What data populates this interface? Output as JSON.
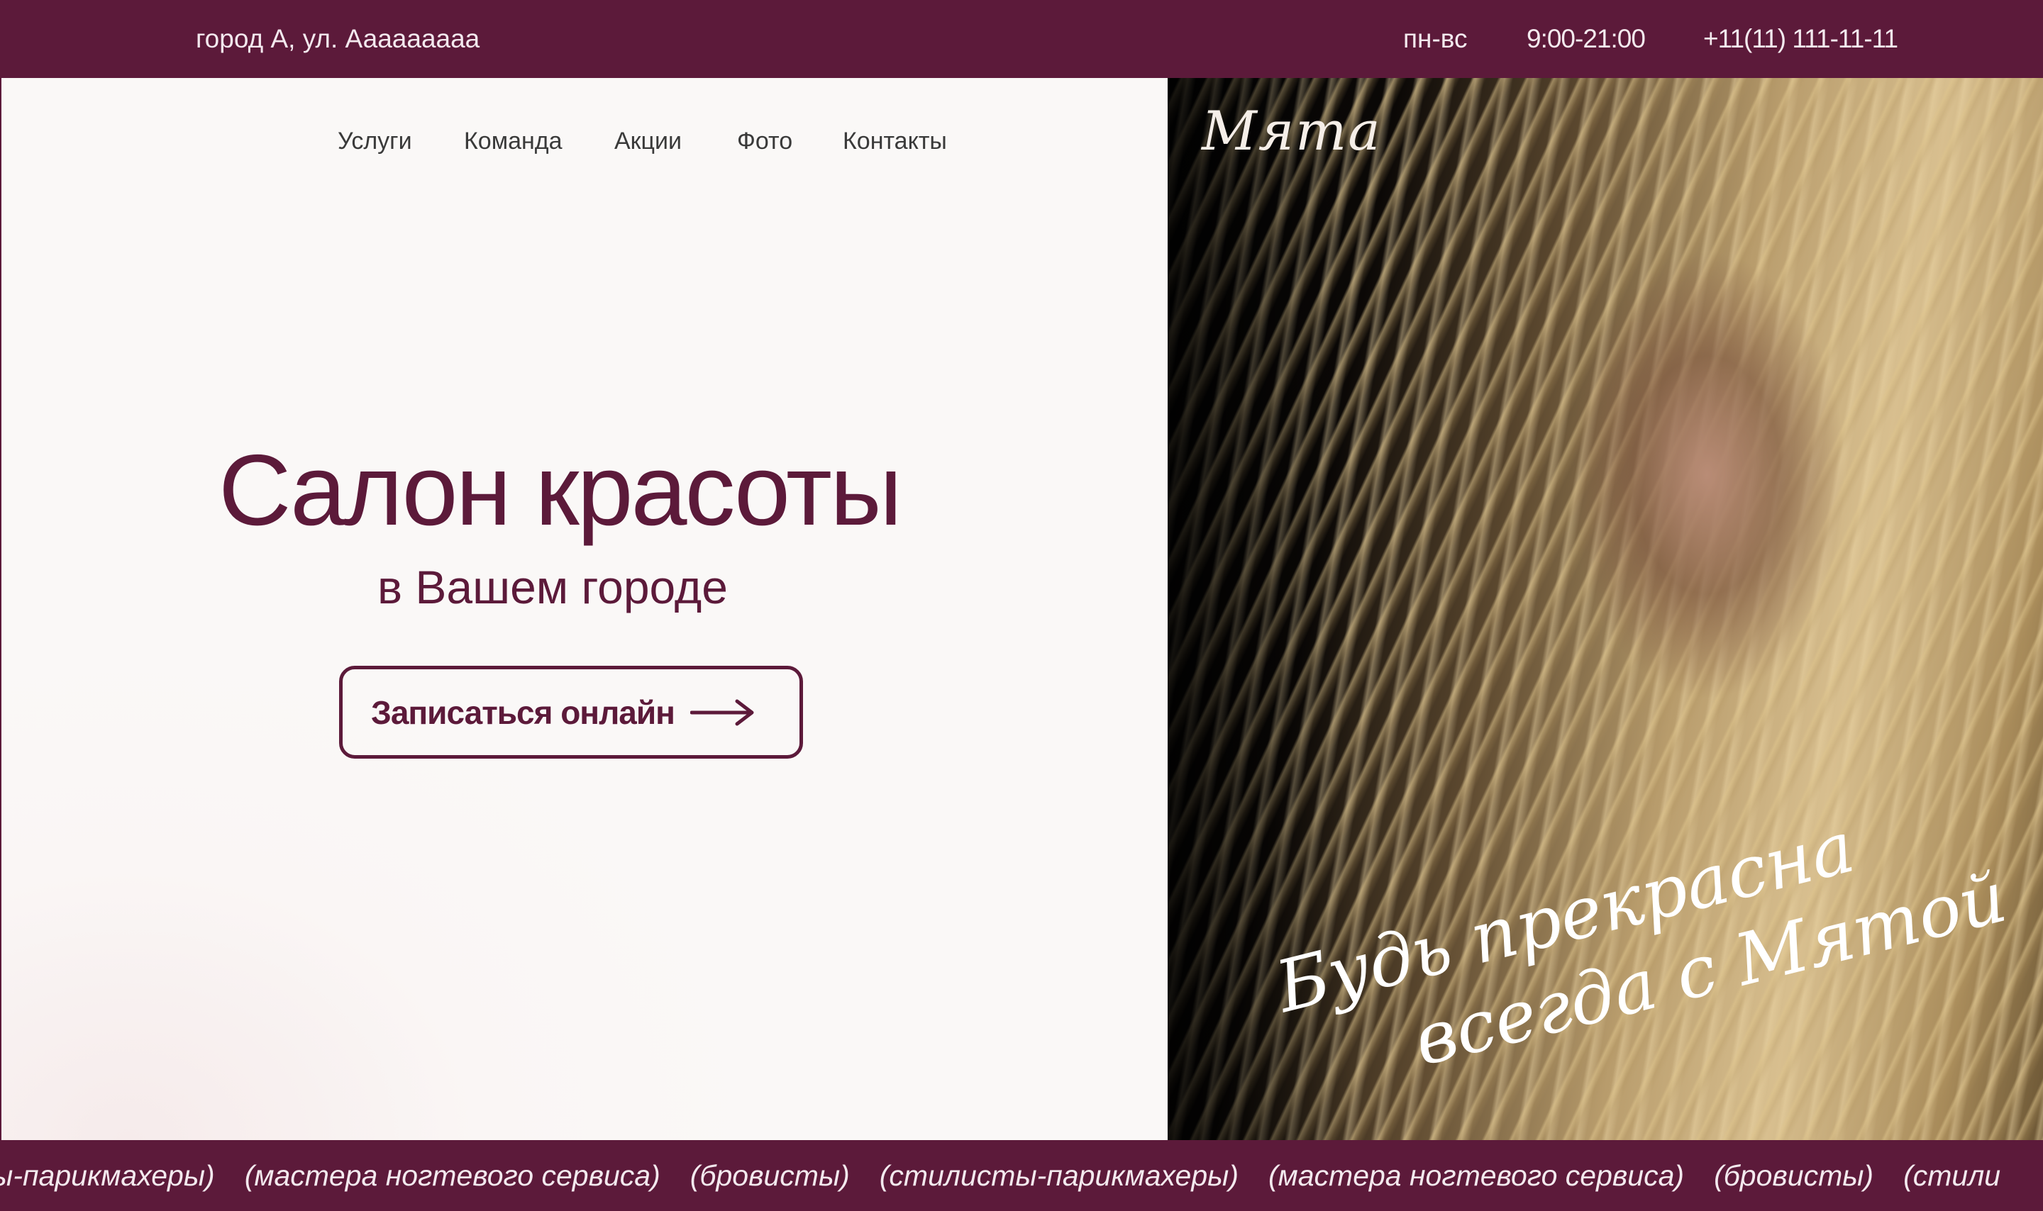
{
  "topbar": {
    "address": "город А, ул. Ааааааааа",
    "days": "пн-вс",
    "hours": "9:00-21:00",
    "phone": "+11(11) 111-11-11"
  },
  "nav": {
    "items": [
      {
        "label": "Услуги"
      },
      {
        "label": "Команда"
      },
      {
        "label": "Акции"
      },
      {
        "label": "Фото"
      },
      {
        "label": "Контакты"
      }
    ]
  },
  "hero": {
    "title": "Салон красоты",
    "subtitle": "в Вашем городе",
    "cta_label": "Записаться онлайн",
    "cta_icon": "arrow-right-icon"
  },
  "photo": {
    "logo": "Мята",
    "slogan_line1": "Будь прекрасна",
    "slogan_line2": "всегда с Мятой"
  },
  "ticker": {
    "items": [
      "ты-парикмахеры)",
      "(мастера ногтевого сервиса)",
      "(бровисты)",
      "(стилисты-парикмахеры)",
      "(мастера ногтевого сервиса)",
      "(бровисты)",
      "(стили"
    ]
  },
  "colors": {
    "brand": "#5c1a3a",
    "background": "#faf7f6",
    "nav_text": "#3a3a3a"
  }
}
